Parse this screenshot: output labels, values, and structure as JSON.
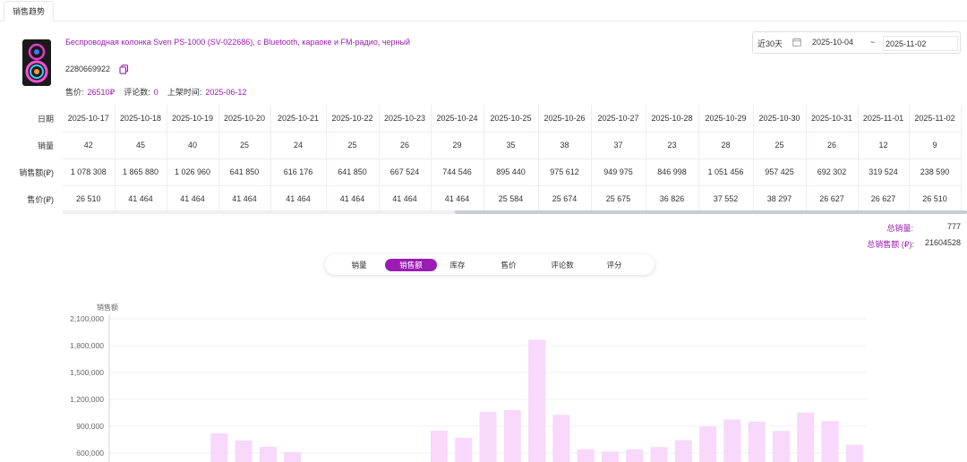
{
  "tab": {
    "label": "销售趋势"
  },
  "product": {
    "title": "Беспроводная колонка Sven PS-1000 (SV-022686), с Bluetooth, караоке и FM-радио, черный",
    "id": "2280669922",
    "price_label": "售价:",
    "price_value": "26510₽",
    "reviews_label": "评论数:",
    "reviews_value": "0",
    "listed_label": "上架时间:",
    "listed_value": "2025-06-12"
  },
  "date_range": {
    "preset": "近30天",
    "start": "2025-10-04",
    "separator": "~",
    "end": "2025-11-02"
  },
  "table": {
    "row_headers": [
      "日期",
      "销量",
      "销售额(₽)",
      "售价(₽)"
    ],
    "dates": [
      "2025-10-17",
      "2025-10-18",
      "2025-10-19",
      "2025-10-20",
      "2025-10-21",
      "2025-10-22",
      "2025-10-23",
      "2025-10-24",
      "2025-10-25",
      "2025-10-26",
      "2025-10-27",
      "2025-10-28",
      "2025-10-29",
      "2025-10-30",
      "2025-10-31",
      "2025-11-01",
      "2025-11-02"
    ],
    "sales": [
      "42",
      "45",
      "40",
      "25",
      "24",
      "25",
      "26",
      "29",
      "35",
      "38",
      "37",
      "23",
      "28",
      "25",
      "26",
      "12",
      "9"
    ],
    "revenue": [
      "1 078 308",
      "1 865 880",
      "1 026 960",
      "641 850",
      "616 176",
      "641 850",
      "667 524",
      "744 546",
      "895 440",
      "975 612",
      "949 975",
      "846 998",
      "1 051 456",
      "957 425",
      "692 302",
      "319 524",
      "238 590"
    ],
    "price": [
      "26 510",
      "41 464",
      "41 464",
      "41 464",
      "41 464",
      "41 464",
      "41 464",
      "41 464",
      "25 584",
      "25 674",
      "25 675",
      "36 826",
      "37 552",
      "38 297",
      "26 627",
      "26 627",
      "26 510"
    ]
  },
  "summary": {
    "total_sales_label": "总销量:",
    "total_sales_value": "777",
    "total_revenue_label": "总销售额 (₽):",
    "total_revenue_value": "21604528"
  },
  "metric_tabs": [
    {
      "label": "销量",
      "active": false
    },
    {
      "label": "销售额",
      "active": true
    },
    {
      "label": "库存",
      "active": false
    },
    {
      "label": "售价",
      "active": false
    },
    {
      "label": "评论数",
      "active": false
    },
    {
      "label": "评分",
      "active": false
    }
  ],
  "colors": {
    "accent": "#9b1bb5",
    "bar": "#f8d8fb",
    "axis": "#cfd3da"
  },
  "chart_data": {
    "type": "bar",
    "ylabel": "销售额",
    "ylim": [
      600000,
      2100000
    ],
    "yticks": [
      "2,100,000",
      "1,800,000",
      "1,500,000",
      "1,200,000",
      "900,000",
      "600,000"
    ],
    "ytick_values": [
      2100000,
      1800000,
      1500000,
      1200000,
      900000,
      600000
    ],
    "grid": true,
    "values": [
      0,
      0,
      0,
      0,
      820000,
      740000,
      670000,
      610000,
      0,
      0,
      0,
      0,
      0,
      850000,
      770000,
      1060000,
      1080000,
      1865880,
      1026960,
      641850,
      616176,
      641850,
      667524,
      744546,
      895440,
      975612,
      949975,
      846998,
      1051456,
      957425,
      692302
    ]
  }
}
